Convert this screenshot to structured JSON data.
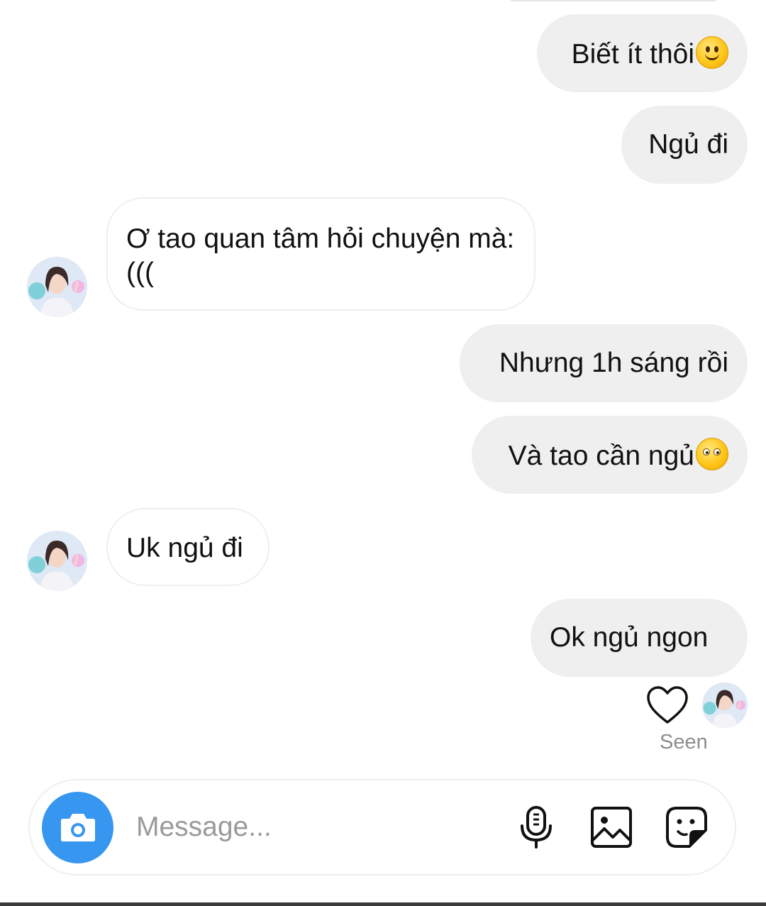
{
  "conversation": {
    "messages": [
      {
        "id": "m1",
        "direction": "sent",
        "text": "Biết ít thôi",
        "emoji": "slightly-smiling-face"
      },
      {
        "id": "m2",
        "direction": "sent",
        "text": "Ngủ đi"
      },
      {
        "id": "m3",
        "direction": "received",
        "text": "Ơ tao quan tâm hỏi chuyện mà:((("
      },
      {
        "id": "m4",
        "direction": "sent",
        "text": "Nhưng 1h sáng rồi"
      },
      {
        "id": "m5",
        "direction": "sent",
        "text": "Và tao cần ngủ",
        "emoji": "face-without-mouth"
      },
      {
        "id": "m6",
        "direction": "received",
        "text": "Uk ngủ đi"
      },
      {
        "id": "m7",
        "direction": "sent",
        "text": "Ok ngủ ngon"
      }
    ],
    "seen_label": "Seen"
  },
  "composer": {
    "placeholder": "Message...",
    "icons": [
      "camera-icon",
      "microphone-icon",
      "gallery-icon",
      "sticker-icon"
    ]
  },
  "colors": {
    "sent_bubble": "#efefef",
    "received_border": "#efefef",
    "accent": "#3797f0",
    "seen_text": "#8e8e8e"
  }
}
